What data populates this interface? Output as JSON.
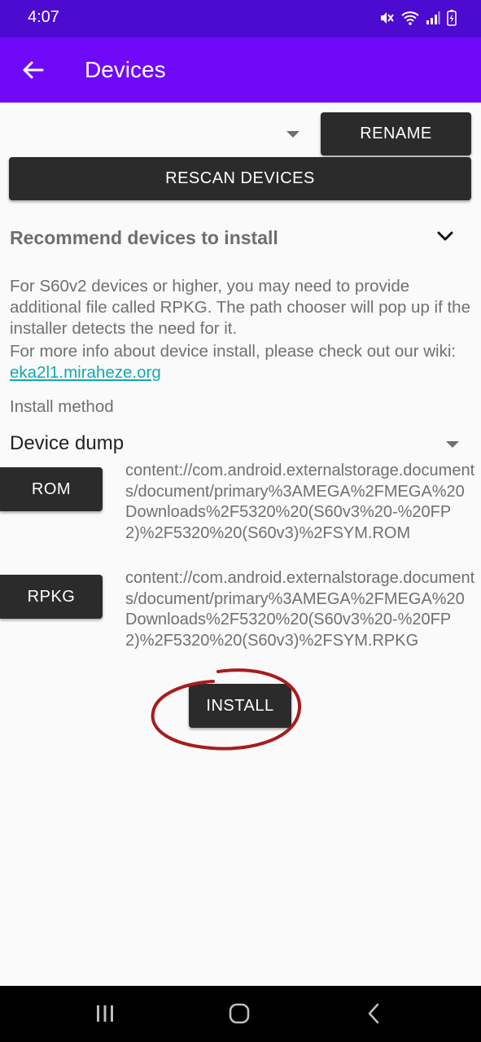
{
  "status_bar": {
    "time": "4:07",
    "icons": [
      "mute-icon",
      "wifi-icon",
      "signal-icon",
      "battery-charging-icon"
    ]
  },
  "app_bar": {
    "title": "Devices",
    "back_icon": "arrow-left-icon",
    "background": "#7009f7"
  },
  "device_selector": {
    "value": "",
    "rename_label": "RENAME"
  },
  "rescan_label": "RESCAN DEVICES",
  "recommend": {
    "title": "Recommend devices to install",
    "icon": "chevron-down-icon"
  },
  "info": {
    "paragraph1": "For S60v2 devices or higher, you may need to provide additional file called RPKG. The path chooser will pop up if the installer detects the need for it.",
    "paragraph2_prefix": "For more info about device install, please check out our wiki: ",
    "wiki_link": "eka2l1.miraheze.org"
  },
  "install_method": {
    "label": "Install method",
    "selected": "Device dump"
  },
  "rom": {
    "button_label": "ROM",
    "path": "content://com.android.externalstorage.documents/document/primary%3AMEGA%2FMEGA%20Downloads%2F5320%20(S60v3%20-%20FP2)%2F5320%20(S60v3)%2FSYM.ROM"
  },
  "rpkg": {
    "button_label": "RPKG",
    "path": "content://com.android.externalstorage.documents/document/primary%3AMEGA%2FMEGA%20Downloads%2F5320%20(S60v3%20-%20FP2)%2F5320%20(S60v3)%2FSYM.RPKG"
  },
  "install_label": "INSTALL",
  "nav_bar": {
    "icons": [
      "recent-apps-icon",
      "home-icon",
      "back-icon"
    ]
  },
  "colors": {
    "status_bar": "#4d0ad1",
    "app_bar": "#7009f7",
    "button": "#2b2b2b",
    "link": "#14a8b4",
    "annotation": "#a81c1c"
  }
}
